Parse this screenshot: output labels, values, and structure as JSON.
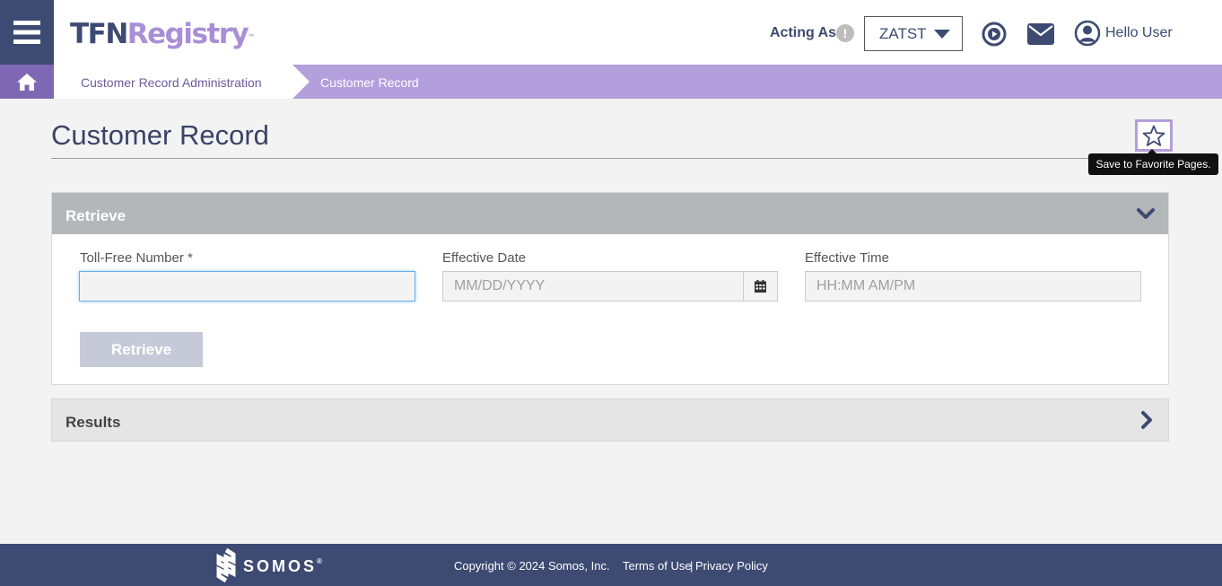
{
  "header": {
    "logo_part1": "TFN",
    "logo_part2": "Registry",
    "logo_tm": "™",
    "acting_as_label": "Acting As",
    "acting_as_value": "ZATST",
    "greeting": "Hello User"
  },
  "breadcrumb": {
    "items": [
      {
        "label": "Customer Record Administration"
      },
      {
        "label": "Customer Record"
      }
    ]
  },
  "page": {
    "title": "Customer Record",
    "favorite_tooltip": "Save to Favorite Pages."
  },
  "retrieve_panel": {
    "title": "Retrieve",
    "tfn_label": "Toll-Free Number *",
    "tfn_value": "",
    "date_label": "Effective Date",
    "date_placeholder": "MM/DD/YYYY",
    "time_label": "Effective Time",
    "time_placeholder": "HH:MM AM/PM",
    "retrieve_button": "Retrieve"
  },
  "results_panel": {
    "title": "Results"
  },
  "footer": {
    "brand": "SOMOS",
    "brand_reg": "®",
    "copyright": "Copyright © 2024 Somos, Inc.",
    "terms": "Terms of Use",
    "separator": "|",
    "privacy": "Privacy Policy"
  },
  "colors": {
    "navy": "#3d4a72",
    "lavender": "#b29fdc",
    "purple": "#7e68b3",
    "panel_header": "#b3b7b9"
  },
  "icons": [
    "menu-icon",
    "warning-icon",
    "caret-down-icon",
    "play-circle-icon",
    "mail-icon",
    "user-icon",
    "home-icon",
    "star-icon",
    "chevron-down-icon",
    "calendar-icon",
    "chevron-right-icon",
    "somos-logo-icon"
  ]
}
